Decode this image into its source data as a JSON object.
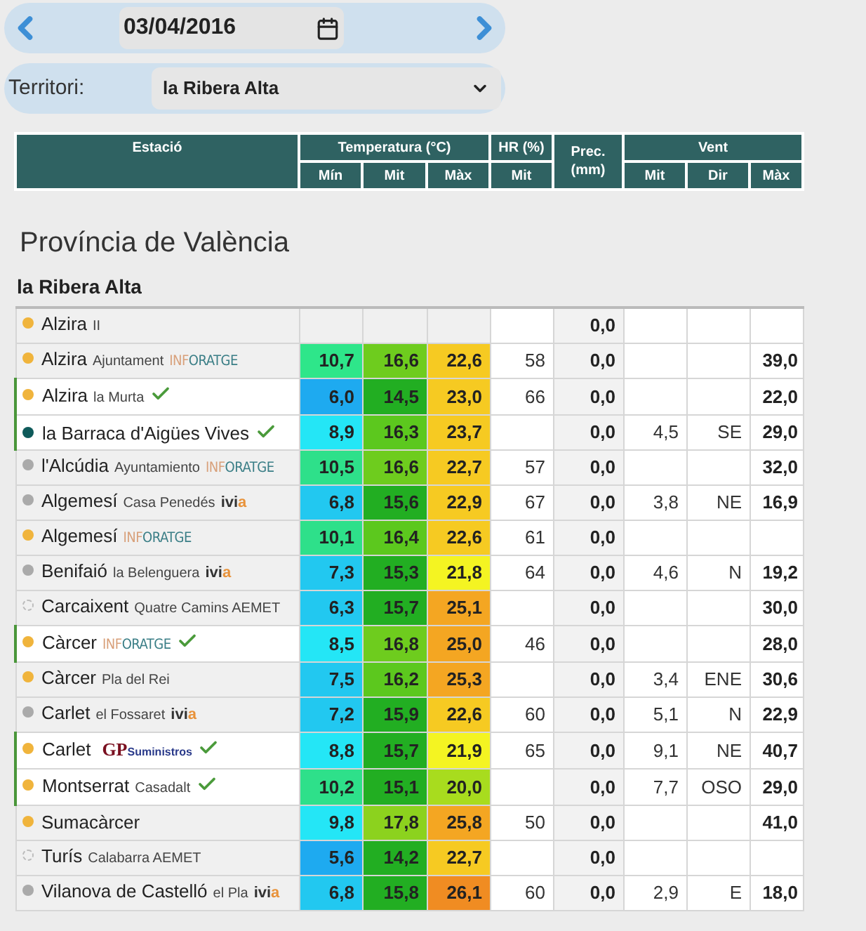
{
  "date_field": {
    "value": "03/04/2016"
  },
  "territory": {
    "label": "Territori:",
    "value": "la Ribera Alta"
  },
  "table_header": {
    "station": "Estació",
    "temperature": "Temperatura (°C)",
    "humidity": "HR (%)",
    "precipitation": "Prec. (mm)",
    "wind": "Vent",
    "sub": {
      "t_min": "Mín",
      "t_mit": "Mit",
      "t_max": "Màx",
      "hr_mit": "Mit",
      "w_mit": "Mit",
      "w_dir": "Dir",
      "w_max": "Màx"
    }
  },
  "province": "Província de València",
  "region": "la Ribera Alta",
  "stations": [
    {
      "name": "Alzira",
      "place": "II",
      "dot": {
        "kind": "solid",
        "color": "#f0b43c"
      },
      "highlighted": false,
      "verified": false,
      "prec": "0,0"
    },
    {
      "name": "Alzira",
      "place": "Ajuntament",
      "source": {
        "kind": "inforatge",
        "text": "INFORATGE"
      },
      "dot": {
        "kind": "solid",
        "color": "#f0b43c"
      },
      "highlighted": false,
      "verified": false,
      "temps": [
        {
          "value": "10,7",
          "color": "#2ee68a"
        },
        {
          "value": "16,6",
          "color": "#6ecc1e"
        },
        {
          "value": "22,6",
          "color": "#f6ca22"
        }
      ],
      "hr": "58",
      "prec": "0,0",
      "wind_max": "39,0"
    },
    {
      "name": "Alzira",
      "place": "la Murta",
      "dot": {
        "kind": "solid",
        "color": "#f0b43c"
      },
      "highlighted": true,
      "verified": true,
      "temps": [
        {
          "value": "6,0",
          "color": "#1eaaf0"
        },
        {
          "value": "14,5",
          "color": "#22ae22"
        },
        {
          "value": "23,0",
          "color": "#f6ca22"
        }
      ],
      "hr": "66",
      "prec": "0,0",
      "wind_max": "22,0"
    },
    {
      "name": "la Barraca d'Aigües Vives",
      "dot": {
        "kind": "solid",
        "color": "#0e5a5a"
      },
      "highlighted": true,
      "verified": true,
      "temps": [
        {
          "value": "8,9",
          "color": "#24e6f6"
        },
        {
          "value": "16,3",
          "color": "#5cc81e"
        },
        {
          "value": "23,7",
          "color": "#f6ca22"
        }
      ],
      "prec": "0,0",
      "wind_mit": "4,5",
      "wind_dir": "SE",
      "wind_max": "29,0"
    },
    {
      "name": "l'Alcúdia",
      "place": "Ayuntamiento",
      "source": {
        "kind": "inforatge",
        "text": "INFORATGE"
      },
      "dot": {
        "kind": "solid",
        "color": "#aaaaaa"
      },
      "highlighted": false,
      "verified": false,
      "temps": [
        {
          "value": "10,5",
          "color": "#2ee08a"
        },
        {
          "value": "16,6",
          "color": "#6ecc1e"
        },
        {
          "value": "22,7",
          "color": "#f6ca22"
        }
      ],
      "hr": "57",
      "prec": "0,0",
      "wind_max": "32,0"
    },
    {
      "name": "Algemesí",
      "place": "Casa Penedés",
      "source": {
        "kind": "ivia",
        "text": "ivia"
      },
      "dot": {
        "kind": "solid",
        "color": "#aaaaaa"
      },
      "highlighted": false,
      "verified": false,
      "temps": [
        {
          "value": "6,8",
          "color": "#22c8f0"
        },
        {
          "value": "15,6",
          "color": "#22ae22"
        },
        {
          "value": "22,9",
          "color": "#f6ca22"
        }
      ],
      "hr": "67",
      "prec": "0,0",
      "wind_mit": "3,8",
      "wind_dir": "NE",
      "wind_max": "16,9"
    },
    {
      "name": "Algemesí",
      "source": {
        "kind": "inforatge",
        "text": "INFORATGE"
      },
      "dot": {
        "kind": "solid",
        "color": "#f0b43c"
      },
      "highlighted": false,
      "verified": false,
      "temps": [
        {
          "value": "10,1",
          "color": "#2ee08a"
        },
        {
          "value": "16,4",
          "color": "#5cc81e"
        },
        {
          "value": "22,6",
          "color": "#f6ca22"
        }
      ],
      "hr": "61",
      "prec": "0,0"
    },
    {
      "name": "Benifaió",
      "place": "la Belenguera",
      "source": {
        "kind": "ivia",
        "text": "ivia"
      },
      "dot": {
        "kind": "solid",
        "color": "#aaaaaa"
      },
      "highlighted": false,
      "verified": false,
      "temps": [
        {
          "value": "7,3",
          "color": "#22c8f0"
        },
        {
          "value": "15,3",
          "color": "#22ae22"
        },
        {
          "value": "21,8",
          "color": "#f4f422"
        }
      ],
      "hr": "64",
      "prec": "0,0",
      "wind_mit": "4,6",
      "wind_dir": "N",
      "wind_max": "19,2"
    },
    {
      "name": "Carcaixent",
      "place": "Quatre Camins AEMET",
      "dot": {
        "kind": "dashed"
      },
      "highlighted": false,
      "verified": false,
      "temps": [
        {
          "value": "6,3",
          "color": "#22c8f0"
        },
        {
          "value": "15,7",
          "color": "#22ae22"
        },
        {
          "value": "25,1",
          "color": "#f4a622"
        }
      ],
      "prec": "0,0",
      "wind_max": "30,0"
    },
    {
      "name": "Càrcer",
      "source": {
        "kind": "inforatge",
        "text": "INFORATGE"
      },
      "dot": {
        "kind": "solid",
        "color": "#f0b43c"
      },
      "highlighted": true,
      "verified": true,
      "temps": [
        {
          "value": "8,5",
          "color": "#24e6f6"
        },
        {
          "value": "16,8",
          "color": "#6ecc1e"
        },
        {
          "value": "25,0",
          "color": "#f4a622"
        }
      ],
      "hr": "46",
      "prec": "0,0",
      "wind_max": "28,0"
    },
    {
      "name": "Càrcer",
      "place": "Pla del Rei",
      "dot": {
        "kind": "solid",
        "color": "#f0b43c"
      },
      "highlighted": false,
      "verified": false,
      "temps": [
        {
          "value": "7,5",
          "color": "#22c8f0"
        },
        {
          "value": "16,2",
          "color": "#5cc81e"
        },
        {
          "value": "25,3",
          "color": "#f4a622"
        }
      ],
      "prec": "0,0",
      "wind_mit": "3,4",
      "wind_dir": "ENE",
      "wind_max": "30,6"
    },
    {
      "name": "Carlet",
      "place": "el Fossaret",
      "source": {
        "kind": "ivia",
        "text": "ivia"
      },
      "dot": {
        "kind": "solid",
        "color": "#aaaaaa"
      },
      "highlighted": false,
      "verified": false,
      "temps": [
        {
          "value": "7,2",
          "color": "#22c8f0"
        },
        {
          "value": "15,9",
          "color": "#22ae22"
        },
        {
          "value": "22,6",
          "color": "#f6ca22"
        }
      ],
      "hr": "60",
      "prec": "0,0",
      "wind_mit": "5,1",
      "wind_dir": "N",
      "wind_max": "22,9"
    },
    {
      "name": "Carlet",
      "source": {
        "kind": "gp",
        "text": "GP",
        "sub": "Suministros"
      },
      "dot": {
        "kind": "solid",
        "color": "#f0b43c"
      },
      "highlighted": true,
      "verified": true,
      "temps": [
        {
          "value": "8,8",
          "color": "#24e6f6"
        },
        {
          "value": "15,7",
          "color": "#22ae22"
        },
        {
          "value": "21,9",
          "color": "#f4f422"
        }
      ],
      "hr": "65",
      "prec": "0,0",
      "wind_mit": "9,1",
      "wind_dir": "NE",
      "wind_max": "40,7"
    },
    {
      "name": "Montserrat",
      "place": "Casadalt",
      "dot": {
        "kind": "solid",
        "color": "#f0b43c"
      },
      "highlighted": true,
      "verified": true,
      "temps": [
        {
          "value": "10,2",
          "color": "#2ee08a"
        },
        {
          "value": "15,1",
          "color": "#22ae22"
        },
        {
          "value": "20,0",
          "color": "#a8dc1e"
        }
      ],
      "prec": "0,0",
      "wind_mit": "7,7",
      "wind_dir": "OSO",
      "wind_max": "29,0"
    },
    {
      "name": "Sumacàrcer",
      "dot": {
        "kind": "solid",
        "color": "#f0b43c"
      },
      "highlighted": false,
      "verified": false,
      "temps": [
        {
          "value": "9,8",
          "color": "#24e6f6"
        },
        {
          "value": "17,8",
          "color": "#8cd21e"
        },
        {
          "value": "25,8",
          "color": "#f4a622"
        }
      ],
      "hr": "50",
      "prec": "0,0",
      "wind_max": "41,0"
    },
    {
      "name": "Turís",
      "place": "Calabarra AEMET",
      "dot": {
        "kind": "dashed"
      },
      "highlighted": false,
      "verified": false,
      "temps": [
        {
          "value": "5,6",
          "color": "#1eaaf0"
        },
        {
          "value": "14,2",
          "color": "#22ae22"
        },
        {
          "value": "22,7",
          "color": "#f6ca22"
        }
      ],
      "prec": "0,0"
    },
    {
      "name": "Vilanova de Castelló",
      "place": "el Pla",
      "source": {
        "kind": "ivia",
        "text": "ivia"
      },
      "dot": {
        "kind": "solid",
        "color": "#aaaaaa"
      },
      "highlighted": false,
      "verified": false,
      "temps": [
        {
          "value": "6,8",
          "color": "#22c8f0"
        },
        {
          "value": "15,8",
          "color": "#22ae22"
        },
        {
          "value": "26,1",
          "color": "#f08c22"
        }
      ],
      "hr": "60",
      "prec": "0,0",
      "wind_mit": "2,9",
      "wind_dir": "E",
      "wind_max": "18,0"
    }
  ]
}
